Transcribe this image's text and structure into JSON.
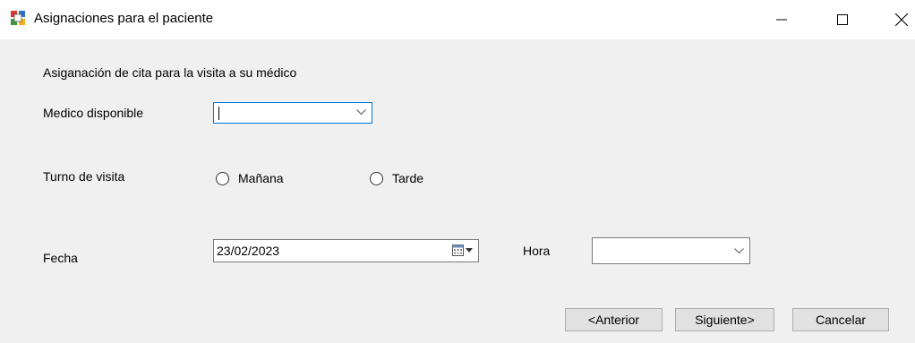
{
  "window": {
    "title": "Asignaciones para el paciente",
    "controls": {
      "minimize": "—",
      "maximize": "☐",
      "close": "✕"
    }
  },
  "form": {
    "heading": "Asiganación de cita para la visita a su médico",
    "medico_label": "Medico disponible",
    "medico_value": "",
    "turno_label": "Turno de visita",
    "turno_options": [
      "Mañana",
      "Tarde"
    ],
    "fecha_label": "Fecha",
    "fecha_value": "23/02/2023",
    "hora_label": "Hora",
    "hora_value": ""
  },
  "buttons": {
    "anterior": "<Anterior",
    "siguiente": "Siguiente>",
    "cancelar": "Cancelar"
  },
  "colors": {
    "focus_border": "#0078d7",
    "window_bg": "#f0f0f0",
    "titlebar_bg": "#ffffff"
  }
}
